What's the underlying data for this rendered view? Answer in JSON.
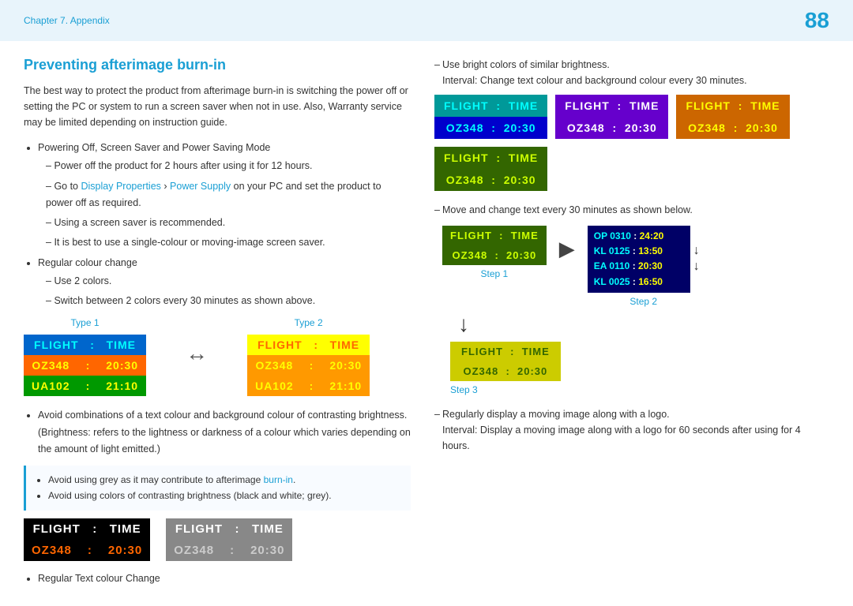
{
  "header": {
    "chapter": "Chapter 7. Appendix",
    "page": "88"
  },
  "section": {
    "title": "Preventing afterimage burn-in",
    "intro": "The best way to protect the product from afterimage burn-in is switching the power off or setting the PC or system to run a screen saver when not in use. Also, Warranty service may be limited depending on instruction guide.",
    "bullets": [
      {
        "text": "Powering Off, Screen Saver and Power Saving Mode",
        "sub": [
          "Power off the product for 2 hours after using it for 12 hours.",
          "Go to Display Properties > Power Supply on your PC and set the product to power off as required.",
          "Using a screen saver is recommended.",
          "It is best to use a single-colour or moving-image screen saver."
        ]
      },
      {
        "text": "Regular colour change",
        "sub": [
          "Use 2 colors.",
          "Switch between 2 colors every 30 minutes as shown above."
        ]
      }
    ],
    "type1_label": "Type 1",
    "type2_label": "Type 2",
    "arrow": "↔",
    "flight_data": {
      "header": "FLIGHT   :   TIME",
      "rows": [
        {
          "col1": "OZ348",
          "sep": ":",
          "col2": "20:30"
        },
        {
          "col1": "UA102",
          "sep": ":",
          "col2": "21:10"
        }
      ]
    },
    "warning": {
      "items": [
        "Avoid using grey as it may contribute to afterimage burn-in.",
        "Avoid using colors of contrasting brightness (black and white; grey)."
      ]
    },
    "bottom_label": "Regular Text colour Change"
  },
  "right": {
    "item1": "Use bright colors of similar brightness.",
    "item1_sub": "Interval: Change text colour and background colour every 30 minutes.",
    "item2": "Move and change text every 30 minutes as shown below.",
    "item2_sub": "",
    "step1_label": "Step 1",
    "step2_label": "Step 2",
    "step3_label": "Step 3",
    "step2_lines": [
      "OP 0310 :  24:20",
      "KL 0125 :  13:50",
      "EA 0110 :  20:30",
      "KL 0025 :  16:50"
    ],
    "item3": "Regularly display a moving image along with a logo.",
    "item3_sub": "Interval: Display a moving image along with a logo for 60 seconds after using for 4 hours."
  }
}
